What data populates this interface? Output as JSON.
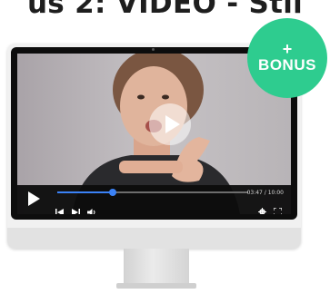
{
  "page": {
    "headline": "us 2: VIDEO - Stil",
    "badge": {
      "plus": "+",
      "label": "BONUS",
      "color": "#2ecc8f"
    }
  },
  "player": {
    "time": "03:47 / 10:00",
    "progress": 0.29,
    "accent_color": "#3b82f6",
    "icons": [
      "play-icon",
      "previous-icon",
      "next-icon",
      "volume-icon",
      "settings-icon",
      "fullscreen-icon"
    ]
  }
}
